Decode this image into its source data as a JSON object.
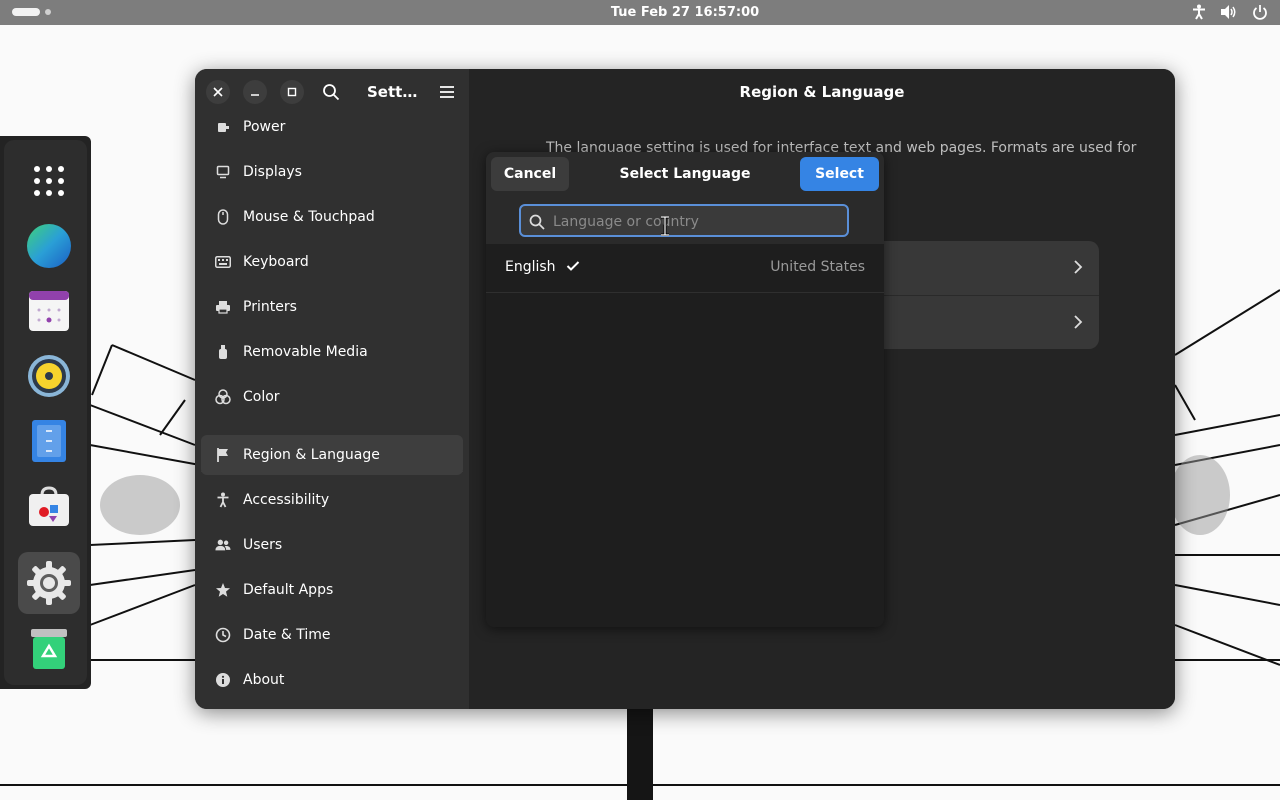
{
  "topbar": {
    "clock": "Tue Feb 27  16:57:00",
    "icons": [
      "activities-indicator",
      "accessibility-icon",
      "volume-icon",
      "power-icon"
    ]
  },
  "dock": {
    "apps": [
      "app-grid-icon",
      "browser-icon",
      "calendar-icon",
      "music-icon",
      "text-editor-icon",
      "software-store-icon",
      "settings-icon",
      "trash-icon"
    ],
    "active": "settings-icon"
  },
  "settings": {
    "sidebar_title": "Sett…",
    "items": [
      {
        "label": "Power",
        "icon": "power-icon"
      },
      {
        "label": "Displays",
        "icon": "display-icon"
      },
      {
        "label": "Mouse & Touchpad",
        "icon": "mouse-icon"
      },
      {
        "label": "Keyboard",
        "icon": "keyboard-icon"
      },
      {
        "label": "Printers",
        "icon": "printer-icon"
      },
      {
        "label": "Removable Media",
        "icon": "usb-icon"
      },
      {
        "label": "Color",
        "icon": "color-icon"
      },
      {
        "label": "Region & Language",
        "icon": "flag-icon"
      },
      {
        "label": "Accessibility",
        "icon": "accessibility-icon"
      },
      {
        "label": "Users",
        "icon": "users-icon"
      },
      {
        "label": "Default Apps",
        "icon": "star-icon"
      },
      {
        "label": "Date & Time",
        "icon": "clock-icon"
      },
      {
        "label": "About",
        "icon": "info-icon"
      }
    ],
    "selected": "Region & Language",
    "content_title": "Region & Language",
    "content_description": "The language setting is used for interface text and web pages. Formats are used for"
  },
  "dialog": {
    "title": "Select Language",
    "cancel_label": "Cancel",
    "select_label": "Select",
    "search_placeholder": "Language or country",
    "search_value": "",
    "languages": [
      {
        "name": "English",
        "country": "United States",
        "selected": true
      }
    ]
  },
  "colors": {
    "accent": "#3584e4",
    "window_bg": "#242424",
    "sidebar_bg": "#303030",
    "topbar_bg": "#7d7d7d"
  }
}
